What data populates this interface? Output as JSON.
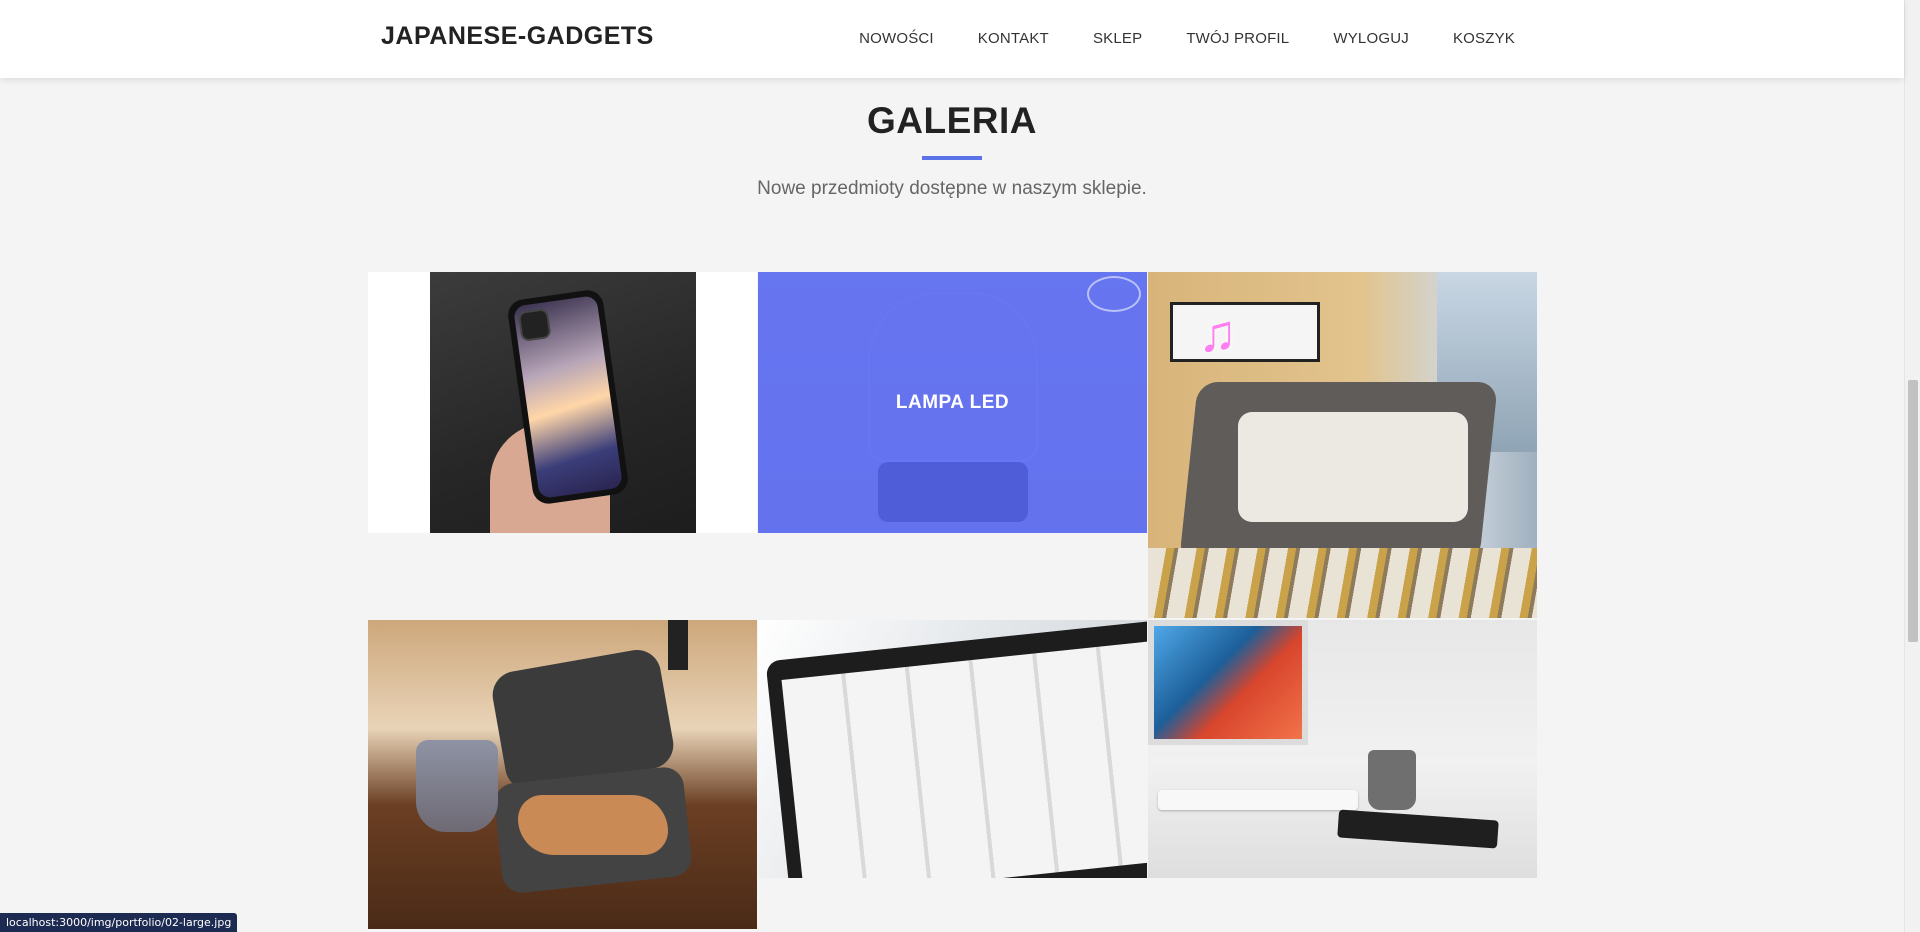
{
  "brand": "JAPANESE-GADGETS",
  "nav": {
    "items": [
      "NOWOŚCI",
      "KONTAKT",
      "SKLEP",
      "TWÓJ PROFIL",
      "WYLOGUJ",
      "KOSZYK"
    ]
  },
  "section": {
    "title": "GALERIA",
    "subtitle": "Nowe przedmioty dostępne w naszym sklepie."
  },
  "gallery": {
    "overlay_caption": "LAMPA LED"
  },
  "status_bar": {
    "url": "localhost:3000/img/portfolio/02-large.jpg"
  },
  "colors": {
    "accent": "#5a72e8",
    "overlay": "#5464f0",
    "status_bg": "#1d2a52"
  }
}
